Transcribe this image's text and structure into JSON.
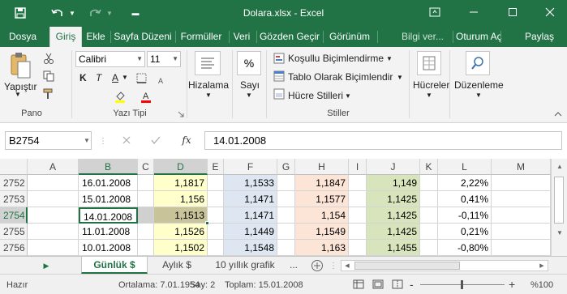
{
  "titlebar": {
    "title": "Dolara.xlsx - Excel"
  },
  "tabs": [
    {
      "label": "Dosya"
    },
    {
      "label": "Giriş"
    },
    {
      "label": "Ekle"
    },
    {
      "label": "Sayfa Düzeni"
    },
    {
      "label": "Formüller"
    },
    {
      "label": "Veri"
    },
    {
      "label": "Gözden Geçir"
    },
    {
      "label": "Görünüm"
    },
    {
      "label": "Bilgi ver..."
    },
    {
      "label": "Oturum Aç"
    },
    {
      "label": "Paylaş"
    }
  ],
  "ribbon": {
    "paste_label": "Yapıştır",
    "clipboard_group": "Pano",
    "font_name": "Calibri",
    "font_size": "11",
    "bold": "K",
    "italic": "T",
    "underline": "A",
    "font_group": "Yazı Tipi",
    "alignment_label": "Hizalama",
    "number_label": "Sayı",
    "conditional": "Koşullu Biçimlendirme",
    "format_table": "Tablo Olarak Biçimlendir",
    "cell_styles": "Hücre Stilleri",
    "styles_group": "Stiller",
    "cells_label": "Hücreler",
    "editing_label": "Düzenleme",
    "percent": "%"
  },
  "formula_bar": {
    "name_box": "B2754",
    "fx": "fx",
    "value": "14.01.2008"
  },
  "grid": {
    "columns": [
      "A",
      "B",
      "C",
      "D",
      "E",
      "F",
      "G",
      "H",
      "I",
      "J",
      "K",
      "L",
      "M"
    ],
    "rows": [
      {
        "n": "2752",
        "B": "16.01.2008",
        "D": "1,1817",
        "F": "1,1533",
        "H": "1,1847",
        "J": "1,149",
        "L": "2,22%"
      },
      {
        "n": "2753",
        "B": "15.01.2008",
        "D": "1,156",
        "F": "1,1471",
        "H": "1,1577",
        "J": "1,1425",
        "L": "0,41%"
      },
      {
        "n": "2754",
        "B": "14.01.2008",
        "D": "1,1513",
        "F": "1,1471",
        "H": "1,154",
        "J": "1,1425",
        "L": "-0,11%"
      },
      {
        "n": "2755",
        "B": "11.01.2008",
        "D": "1,1526",
        "F": "1,1449",
        "H": "1,1549",
        "J": "1,1425",
        "L": "0,21%"
      },
      {
        "n": "2756",
        "B": "10.01.2008",
        "D": "1,1502",
        "F": "1,1548",
        "H": "1,163",
        "J": "1,1455",
        "L": "-0,80%"
      }
    ],
    "colors": {
      "D": "#ffffcc",
      "F": "#dde6f1",
      "H": "#fce4d6",
      "J": "#d8e4bc"
    }
  },
  "sheets": {
    "tabs": [
      {
        "label": "Günlük $"
      },
      {
        "label": "Aylık $"
      },
      {
        "label": "10 yıllık grafik"
      }
    ],
    "more": "..."
  },
  "status": {
    "ready": "Hazır",
    "average": "Ortalama: 7.01.1954",
    "count": "Say: 2",
    "sum": "Toplam: 15.01.2008",
    "zoom": "%100",
    "minus": "-",
    "plus": "+"
  }
}
